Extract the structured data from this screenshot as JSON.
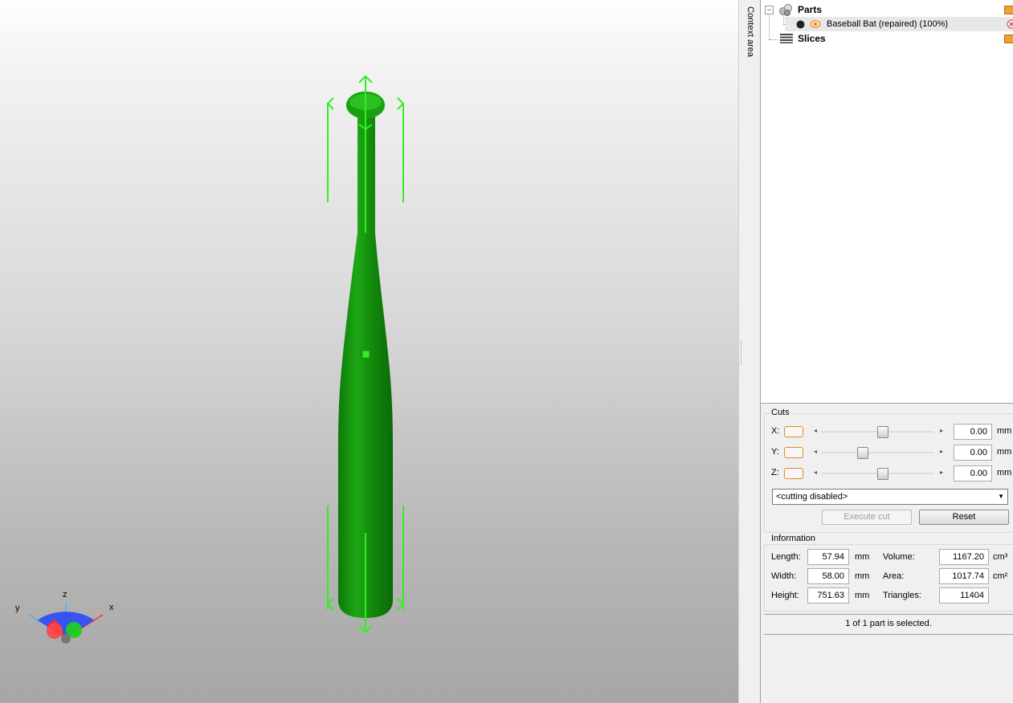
{
  "context_area": {
    "label": "Context area"
  },
  "tree": {
    "expander": "−",
    "parts": {
      "label": "Parts"
    },
    "model": {
      "label": "Baseball Bat (repaired) (100%)"
    },
    "slices": {
      "label": "Slices"
    }
  },
  "cuts": {
    "title": "Cuts",
    "axes": [
      {
        "label": "X:",
        "value": "0.00",
        "unit": "mm",
        "slider_position": 0.55
      },
      {
        "label": "Y:",
        "value": "0.00",
        "unit": "mm",
        "slider_position": 0.35
      },
      {
        "label": "Z:",
        "value": "0.00",
        "unit": "mm",
        "slider_position": 0.55
      }
    ],
    "mode": {
      "selected": "<cutting disabled>"
    },
    "execute_label": "Execute cut",
    "reset_label": "Reset"
  },
  "information": {
    "title": "Information",
    "length": {
      "label": "Length:",
      "value": "57.94",
      "unit": "mm"
    },
    "width": {
      "label": "Width:",
      "value": "58.00",
      "unit": "mm"
    },
    "height": {
      "label": "Height:",
      "value": "751.63",
      "unit": "mm"
    },
    "volume": {
      "label": "Volume:",
      "value": "1167.20",
      "unit": "cm³"
    },
    "area": {
      "label": "Area:",
      "value": "1017.74",
      "unit": "cm²"
    },
    "triangles": {
      "label": "Triangles:",
      "value": "11404"
    }
  },
  "status": {
    "text": "1 of 1 part is selected."
  },
  "axis_gizmo": {
    "x": "x",
    "y": "y",
    "z": "z"
  },
  "colors": {
    "model": "#1a9e10",
    "handles": "#33ee22",
    "accent_orange": "#e08a20"
  }
}
